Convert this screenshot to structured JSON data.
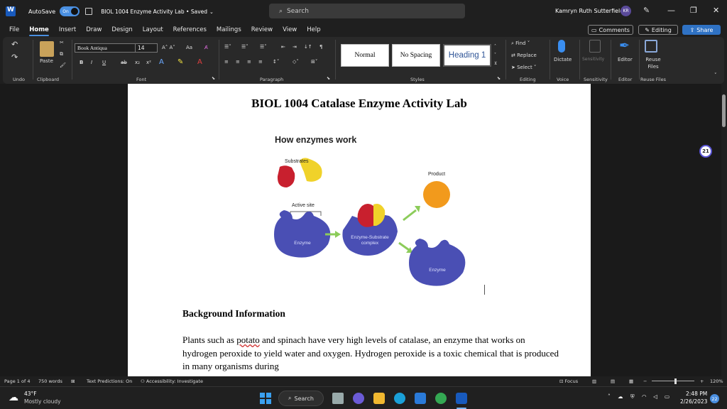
{
  "titlebar": {
    "autosave_label": "AutoSave",
    "autosave_state": "On",
    "doc_title": "BIOL 1004 Enzyme Activity Lab • Saved",
    "search_placeholder": "Search",
    "user_name": "Kamryn Ruth Sutterfield",
    "user_initials": "KR"
  },
  "menu": {
    "tabs": [
      "File",
      "Home",
      "Insert",
      "Draw",
      "Design",
      "Layout",
      "References",
      "Mailings",
      "Review",
      "View",
      "Help"
    ],
    "active_tab": "Home",
    "comments_label": "Comments",
    "editing_label": "Editing",
    "share_label": "Share"
  },
  "ribbon": {
    "groups": {
      "undo": "Undo",
      "clipboard": "Clipboard",
      "font": "Font",
      "paragraph": "Paragraph",
      "styles": "Styles",
      "editing": "Editing",
      "voice": "Voice",
      "sensitivity": "Sensitivity",
      "editor": "Editor",
      "reuse_files": "Reuse Files"
    },
    "paste_label": "Paste",
    "font_name": "Book Antiqua",
    "font_size": "14",
    "styles": [
      "Normal",
      "No Spacing",
      "Heading 1"
    ],
    "find_label": "Find",
    "replace_label": "Replace",
    "select_label": "Select",
    "dictate_label": "Dictate",
    "sensitivity_label": "Sensitivity",
    "editor_label": "Editor",
    "reuse_label": "Reuse Files"
  },
  "document": {
    "heading": "BIOL 1004 Catalase Enzyme Activity Lab",
    "figure": {
      "title": "How enzymes work",
      "substrates_label": "Substrates",
      "product_label": "Product",
      "active_site_label": "Active site",
      "enzyme_label_1": "Enzyme",
      "complex_label": "Enzyme-Substrate complex",
      "enzyme_label_2": "Enzyme"
    },
    "section_heading": "Background Information",
    "paragraph_before": "Plants such as ",
    "paragraph_flagged_word": "potato",
    "paragraph_after": " and spinach have very high levels of catalase, an enzyme that works on hydrogen peroxide to yield water and oxygen.  Hydrogen peroxide is a toxic chemical that is produced in many organisms during"
  },
  "comment_count": "21",
  "statusbar": {
    "page": "Page 1 of 4",
    "words": "750 words",
    "text_predictions": "Text Predictions: On",
    "accessibility": "Accessibility: Investigate",
    "focus": "Focus",
    "zoom": "120%"
  },
  "taskbar": {
    "weather_temp": "43°F",
    "weather_desc": "Mostly cloudy",
    "search_label": "Search",
    "time": "2:48 PM",
    "date": "2/26/2023",
    "notification_count": "22"
  },
  "colors": {
    "accent": "#2f72c4",
    "enzyme_blue": "#4a4fb4",
    "substrate_red": "#c8202e",
    "substrate_yellow": "#f0d22a",
    "product_orange": "#f29a1c",
    "arrow_green": "#8ccc5a"
  }
}
